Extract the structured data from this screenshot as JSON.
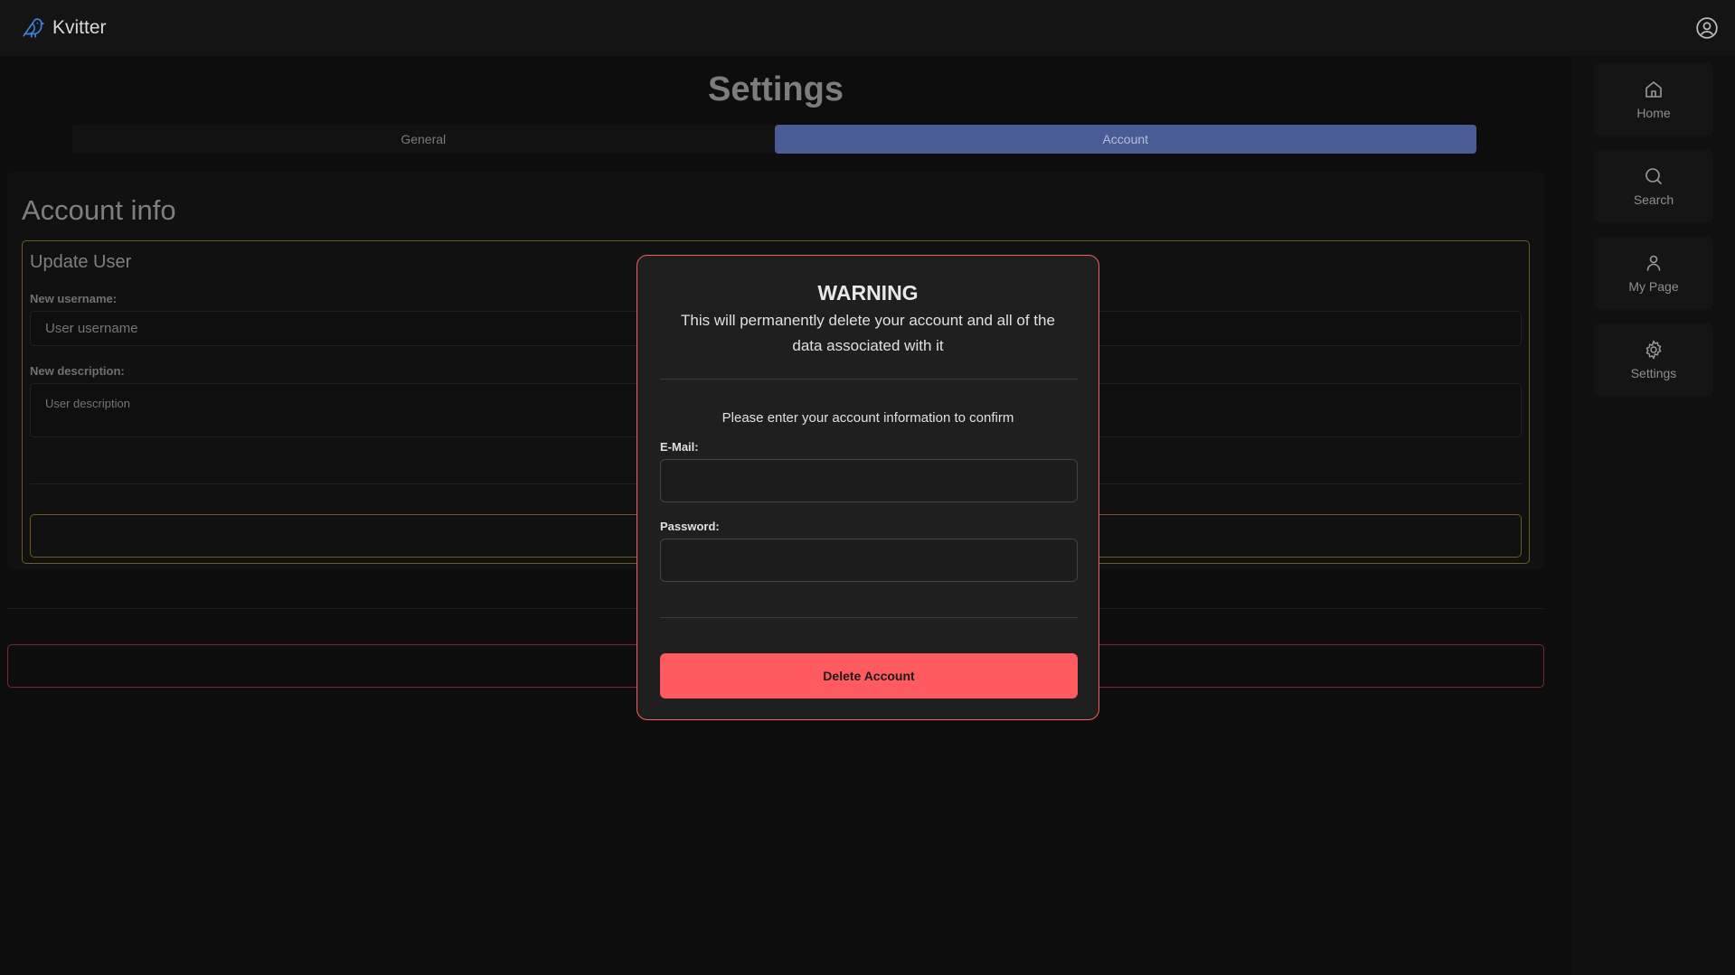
{
  "app": {
    "name": "Kvitter"
  },
  "colors": {
    "accent": "#4a5c95",
    "danger": "#ff5a5f",
    "warning_border": "#6e5a1e"
  },
  "sidebar": {
    "items": [
      {
        "label": "Home",
        "icon": "home-icon"
      },
      {
        "label": "Search",
        "icon": "search-icon"
      },
      {
        "label": "My Page",
        "icon": "user-icon"
      },
      {
        "label": "Settings",
        "icon": "gear-icon"
      }
    ]
  },
  "settings": {
    "title": "Settings",
    "tabs": [
      {
        "label": "General",
        "active": false
      },
      {
        "label": "Account",
        "active": true
      }
    ],
    "account_info": {
      "title": "Account info",
      "update_user": {
        "title": "Update User",
        "username_label": "New username:",
        "username_placeholder": "User username",
        "description_label": "New description:",
        "description_placeholder": "User description"
      }
    }
  },
  "modal": {
    "title": "WARNING",
    "message": "This will permanently delete your account and all of the data associated with it",
    "confirm_text": "Please enter your account information to confirm",
    "email_label": "E-Mail:",
    "email_value": "",
    "password_label": "Password:",
    "password_value": "",
    "delete_button": "Delete Account"
  }
}
